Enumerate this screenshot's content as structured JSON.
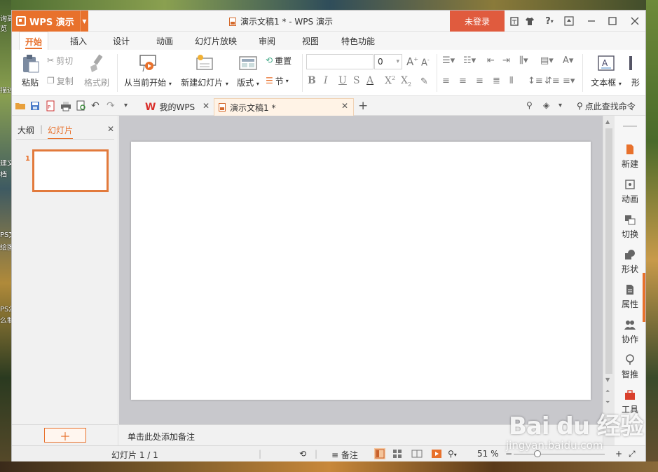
{
  "desktop": {
    "left_texts": [
      "询高",
      "览",
      "描述",
      "建文",
      "档",
      "PS文",
      "绘图",
      "PS演",
      "么制"
    ]
  },
  "titlebar": {
    "app_name": "WPS 演示",
    "doc_title": "演示文稿1 * - WPS 演示",
    "login": "未登录",
    "help": "?",
    "brand_color": "#e8712c"
  },
  "tabs": [
    {
      "label": "开始",
      "active": true
    },
    {
      "label": "插入"
    },
    {
      "label": "设计"
    },
    {
      "label": "动画"
    },
    {
      "label": "幻灯片放映"
    },
    {
      "label": "审阅"
    },
    {
      "label": "视图"
    },
    {
      "label": "特色功能"
    }
  ],
  "ribbon": {
    "paste": "粘贴",
    "cut": "剪切",
    "copy": "复制",
    "format_painter": "格式刷",
    "from_current": "从当前开始",
    "new_slide": "新建幻灯片",
    "layout": "版式",
    "reset": "重置",
    "section": "节",
    "font_size": "0",
    "textbox": "文本框",
    "shape_partial": "形"
  },
  "quickaccess": {
    "my_wps": "我的WPS",
    "doc_tab": "演示文稿1 *",
    "search": "点此查找命令"
  },
  "leftpanel": {
    "tab_outline": "大纲",
    "tab_slides": "幻灯片",
    "slide_number": "1"
  },
  "notes": {
    "placeholder": "单击此处添加备注"
  },
  "rightpane": [
    {
      "label": "新建",
      "icon": "new-icon"
    },
    {
      "label": "动画",
      "icon": "animation-icon"
    },
    {
      "label": "切换",
      "icon": "transition-icon"
    },
    {
      "label": "形状",
      "icon": "shape-icon"
    },
    {
      "label": "属性",
      "icon": "property-icon"
    },
    {
      "label": "协作",
      "icon": "collaborate-icon"
    },
    {
      "label": "智推",
      "icon": "recommend-icon"
    },
    {
      "label": "工具",
      "icon": "tools-icon"
    }
  ],
  "statusbar": {
    "slide_info": "幻灯片 1 / 1",
    "notes": "备注",
    "zoom": "51 %"
  },
  "watermark": {
    "brand": "Bai du 经验",
    "url": "jingyan.baidu.com"
  }
}
